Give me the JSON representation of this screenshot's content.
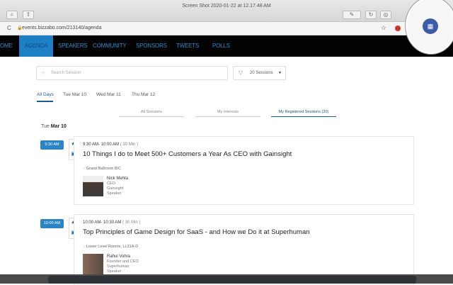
{
  "window": {
    "title": "Screen Shot 2020-01-22 at 12.17.48 AM"
  },
  "browser": {
    "url": "events.bizzabo.com/213140/agenda"
  },
  "nav": {
    "items": [
      "OME",
      "AGENDA",
      "SPEAKERS",
      "COMMUNITY",
      "SPONSORS",
      "TWEETS",
      "POLLS"
    ]
  },
  "search": {
    "placeholder": "Search Session"
  },
  "filter": {
    "label": "20 Sessions"
  },
  "days": [
    "All Days",
    "Tue Mar 10",
    "Wed Mar 11",
    "Thu Mar 12"
  ],
  "subtabs": [
    "All Sessions",
    "My Interests",
    "My Registered Sessions (20)"
  ],
  "day_heading": {
    "weekday": "Tue",
    "date": "Mar 10"
  },
  "sessions": [
    {
      "badge": "9:30 AM",
      "time": "9:30 AM- 10:00 AM",
      "duration": "( 30 Min )",
      "title": "10 Things I do to Meet 500+ Customers a Year As CEO with Gainsight",
      "room": "Grand Ballroom B/C",
      "speaker": {
        "name": "Nick Mehta",
        "role": "CEO",
        "company": "Gainsight",
        "type": "Speaker"
      }
    },
    {
      "badge": "10:00 AM",
      "time": "10:00 AM- 10:30 AM",
      "duration": "( 30 Min )",
      "title": "Top Principles of Game Design for SaaS - and How we Do it at Superhuman",
      "room": "Lower Level Rooms, LL21A-D",
      "speaker": {
        "name": "Rahul Vohra",
        "role": "Founder and CEO",
        "company": "Superhuman",
        "type": "Speaker"
      }
    }
  ]
}
